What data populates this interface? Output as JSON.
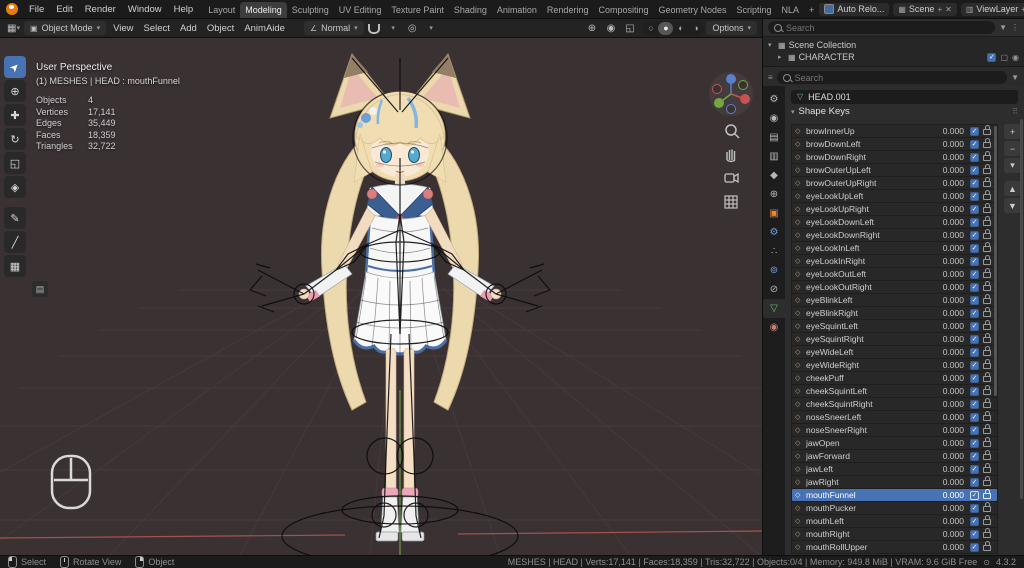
{
  "topbar": {
    "menus": [
      "File",
      "Edit",
      "Render",
      "Window",
      "Help"
    ],
    "workspaces": [
      {
        "label": "Layout"
      },
      {
        "label": "Modeling",
        "active": true
      },
      {
        "label": "Sculpting"
      },
      {
        "label": "UV Editing"
      },
      {
        "label": "Texture Paint"
      },
      {
        "label": "Shading"
      },
      {
        "label": "Animation"
      },
      {
        "label": "Rendering"
      },
      {
        "label": "Compositing"
      },
      {
        "label": "Geometry Nodes"
      },
      {
        "label": "Scripting"
      },
      {
        "label": "NLA"
      },
      {
        "label": "+"
      }
    ],
    "auto_reload_label": "Auto Relo...",
    "scene_label": "Scene",
    "viewlayer_label": "ViewLayer"
  },
  "viewport_header": {
    "mode_label": "Object Mode",
    "menus": [
      "View",
      "Select",
      "Add",
      "Object",
      "AnimAide"
    ],
    "orientation_label": "Normal",
    "options_label": "Options"
  },
  "viewport": {
    "overlay": {
      "title": "User Perspective",
      "subtitle": "(1) MESHES | HEAD : mouthFunnel",
      "stats": [
        [
          "Objects",
          "4"
        ],
        [
          "Vertices",
          "17,141"
        ],
        [
          "Edges",
          "35,449"
        ],
        [
          "Faces",
          "18,359"
        ],
        [
          "Triangles",
          "32,722"
        ]
      ]
    }
  },
  "toolbar": {
    "tools": [
      {
        "name": "select-box",
        "glyph": "➤",
        "active": true,
        "rotate": true
      },
      {
        "name": "cursor",
        "glyph": "⊕"
      },
      {
        "name": "move",
        "glyph": "✚"
      },
      {
        "name": "rotate",
        "glyph": "↻"
      },
      {
        "name": "scale",
        "glyph": "◱"
      },
      {
        "name": "transform",
        "glyph": "◈"
      },
      {
        "name": "annotate",
        "glyph": "✎"
      },
      {
        "name": "measure",
        "glyph": "╱"
      },
      {
        "name": "add-cube",
        "glyph": "▦"
      }
    ]
  },
  "outliner": {
    "search_placeholder": "Search",
    "rows": [
      {
        "label": "Scene Collection",
        "disclosure": "▾",
        "indent": 0
      },
      {
        "label": "CHARACTER",
        "disclosure": "▸",
        "indent": 1
      }
    ]
  },
  "properties": {
    "search_placeholder": "Search",
    "tabs": [
      {
        "name": "tool",
        "glyph": "⚙",
        "color": "#b8b8b8"
      },
      {
        "name": "render",
        "glyph": "◉",
        "color": "#b8b8b8"
      },
      {
        "name": "output",
        "glyph": "▤",
        "color": "#b8b8b8"
      },
      {
        "name": "view-layer",
        "glyph": "▥",
        "color": "#b8b8b8"
      },
      {
        "name": "scene",
        "glyph": "◆",
        "color": "#b8b8b8"
      },
      {
        "name": "world",
        "glyph": "⊕",
        "color": "#b8b8b8"
      },
      {
        "name": "object",
        "glyph": "▣",
        "color": "#e58a3a"
      },
      {
        "name": "modifiers",
        "glyph": "⚙",
        "color": "#6f9fd8"
      },
      {
        "name": "particles",
        "glyph": "∴",
        "color": "#b8b8b8"
      },
      {
        "name": "physics",
        "glyph": "⊚",
        "color": "#6f9fd8"
      },
      {
        "name": "constraints",
        "glyph": "⊘",
        "color": "#b8b8b8"
      },
      {
        "name": "data",
        "glyph": "▽",
        "color": "#6fc26f",
        "active": true
      },
      {
        "name": "material",
        "glyph": "◉",
        "color": "#c97f6f"
      }
    ],
    "breadcrumb": "HEAD.001",
    "panel_title": "Shape Keys",
    "shapekey_icon_glyph": "◇",
    "list_buttons": [
      {
        "name": "add",
        "glyph": "+"
      },
      {
        "name": "remove",
        "glyph": "−"
      },
      {
        "name": "specials",
        "glyph": "▾"
      },
      {
        "name": "move-up",
        "glyph": "▲",
        "gapped": true
      },
      {
        "name": "move-down",
        "glyph": "▼"
      }
    ],
    "shape_keys": [
      {
        "name": "browInnerUp",
        "value": "0.000"
      },
      {
        "name": "browDownLeft",
        "value": "0.000"
      },
      {
        "name": "browDownRight",
        "value": "0.000"
      },
      {
        "name": "browOuterUpLeft",
        "value": "0.000"
      },
      {
        "name": "browOuterUpRight",
        "value": "0.000"
      },
      {
        "name": "eyeLookUpLeft",
        "value": "0.000"
      },
      {
        "name": "eyeLookUpRight",
        "value": "0.000"
      },
      {
        "name": "eyeLookDownLeft",
        "value": "0.000"
      },
      {
        "name": "eyeLookDownRight",
        "value": "0.000"
      },
      {
        "name": "eyeLookInLeft",
        "value": "0.000"
      },
      {
        "name": "eyeLookInRight",
        "value": "0.000"
      },
      {
        "name": "eyeLookOutLeft",
        "value": "0.000"
      },
      {
        "name": "eyeLookOutRight",
        "value": "0.000"
      },
      {
        "name": "eyeBlinkLeft",
        "value": "0.000"
      },
      {
        "name": "eyeBlinkRight",
        "value": "0.000"
      },
      {
        "name": "eyeSquintLeft",
        "value": "0.000"
      },
      {
        "name": "eyeSquintRight",
        "value": "0.000"
      },
      {
        "name": "eyeWideLeft",
        "value": "0.000"
      },
      {
        "name": "eyeWideRight",
        "value": "0.000"
      },
      {
        "name": "cheekPuff",
        "value": "0.000"
      },
      {
        "name": "cheekSquintLeft",
        "value": "0.000"
      },
      {
        "name": "cheekSquintRight",
        "value": "0.000"
      },
      {
        "name": "noseSneerLeft",
        "value": "0.000"
      },
      {
        "name": "noseSneerRight",
        "value": "0.000"
      },
      {
        "name": "jawOpen",
        "value": "0.000"
      },
      {
        "name": "jawForward",
        "value": "0.000"
      },
      {
        "name": "jawLeft",
        "value": "0.000"
      },
      {
        "name": "jawRight",
        "value": "0.000"
      },
      {
        "name": "mouthFunnel",
        "value": "0.000",
        "selected": true
      },
      {
        "name": "mouthPucker",
        "value": "0.000"
      },
      {
        "name": "mouthLeft",
        "value": "0.000"
      },
      {
        "name": "mouthRight",
        "value": "0.000"
      },
      {
        "name": "mouthRollUpper",
        "value": "0.000"
      }
    ]
  },
  "statusbar": {
    "hints": [
      {
        "label": "Select",
        "button": "left"
      },
      {
        "label": "Rotate View",
        "button": "middle"
      },
      {
        "label": "Object",
        "button": "right"
      }
    ],
    "info": "MESHES | HEAD | Verts:17,141 | Faces:18,359 | Tris:32,722 | Objects:0/4 | Memory: 949.8 MiB | VRAM: 9.6 GiB Free",
    "version": "4.3.2"
  },
  "colors": {
    "accent": "#4772b3",
    "viewport_bg": "#3a3133"
  }
}
